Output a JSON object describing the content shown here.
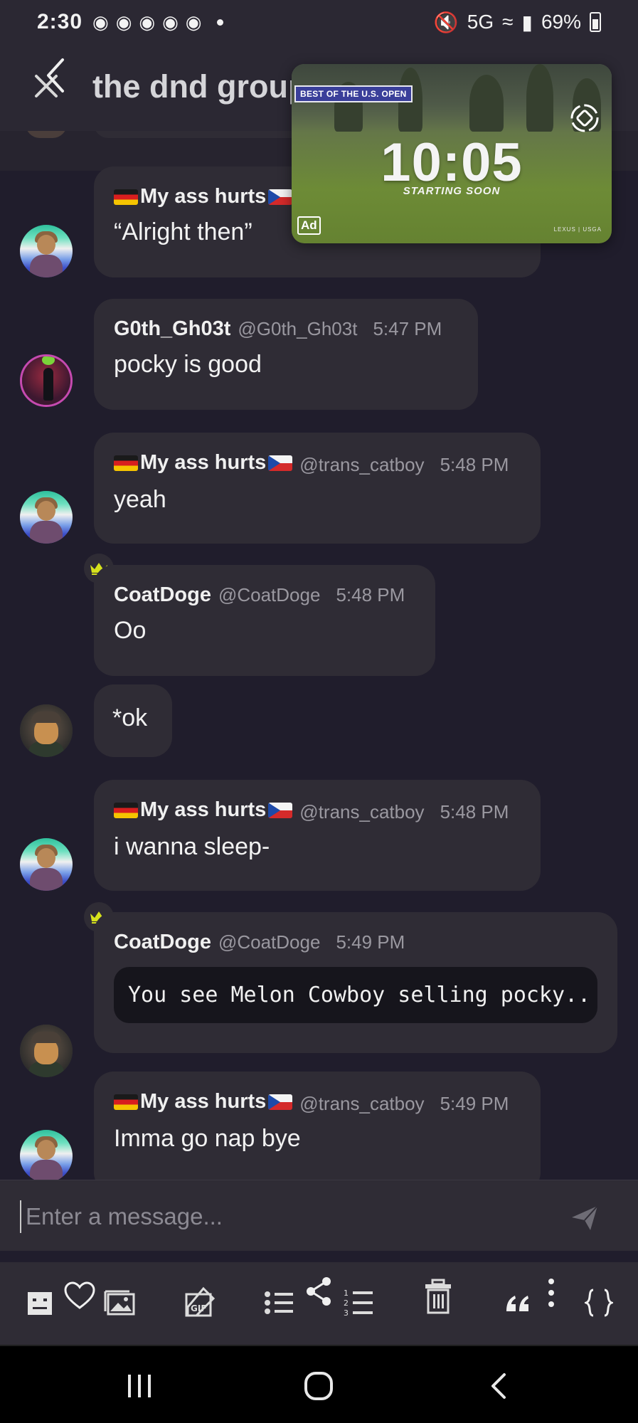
{
  "status_bar": {
    "time": "2:30",
    "app_icons": [
      "discord-icon",
      "discord-icon",
      "discord-icon",
      "discord-icon",
      "discord-icon"
    ],
    "network": "5G",
    "battery": "69%"
  },
  "header": {
    "title": "the dnd group"
  },
  "ad_video": {
    "tag": "BEST OF THE U.S. OPEN",
    "countdown": "10:05",
    "subtitle": "STARTING SOON",
    "ad_label": "Ad",
    "sponsor": "LEXUS | USGA"
  },
  "messages": [
    {
      "name": "My ass hurts",
      "handle": "",
      "time": "",
      "text": "“Alright then”",
      "flags": true
    },
    {
      "name": "G0th_Gh03t",
      "handle": "@G0th_Gh03t",
      "time": "5:47 PM",
      "text": "pocky is good",
      "flags": false
    },
    {
      "name": "My ass hurts",
      "handle": "@trans_catboy",
      "time": "5:48 PM",
      "text": "yeah",
      "flags": true
    },
    {
      "name": "CoatDoge",
      "handle": "@CoatDoge",
      "time": "5:48 PM",
      "text": "Oo",
      "flags": false
    },
    {
      "name": "",
      "handle": "",
      "time": "",
      "text": "*ok",
      "flags": false
    },
    {
      "name": "My ass hurts",
      "handle": "@trans_catboy",
      "time": "5:48 PM",
      "text": "i wanna sleep-",
      "flags": true
    },
    {
      "name": "CoatDoge",
      "handle": "@CoatDoge",
      "time": "5:49 PM",
      "text": "You see Melon Cowboy selling pocky..",
      "flags": false
    },
    {
      "name": "My ass hurts",
      "handle": "@trans_catboy",
      "time": "5:49 PM",
      "text": "Imma go nap bye",
      "flags": true
    }
  ],
  "composer": {
    "placeholder": "Enter a message..."
  },
  "toolbar": {
    "icons": [
      "emoji-face-icon",
      "heart-icon",
      "image-icon",
      "gif-icon",
      "bullet-list-icon",
      "share-icon",
      "numbered-list-icon",
      "trash-icon",
      "quote-icon",
      "more-icon",
      "code-icon"
    ]
  },
  "colors": {
    "background": "#201d2c",
    "bubble": "#2f2c35",
    "header": "#2b2833",
    "crown": "#d6e21c",
    "muted_text": "#9a98a0"
  }
}
